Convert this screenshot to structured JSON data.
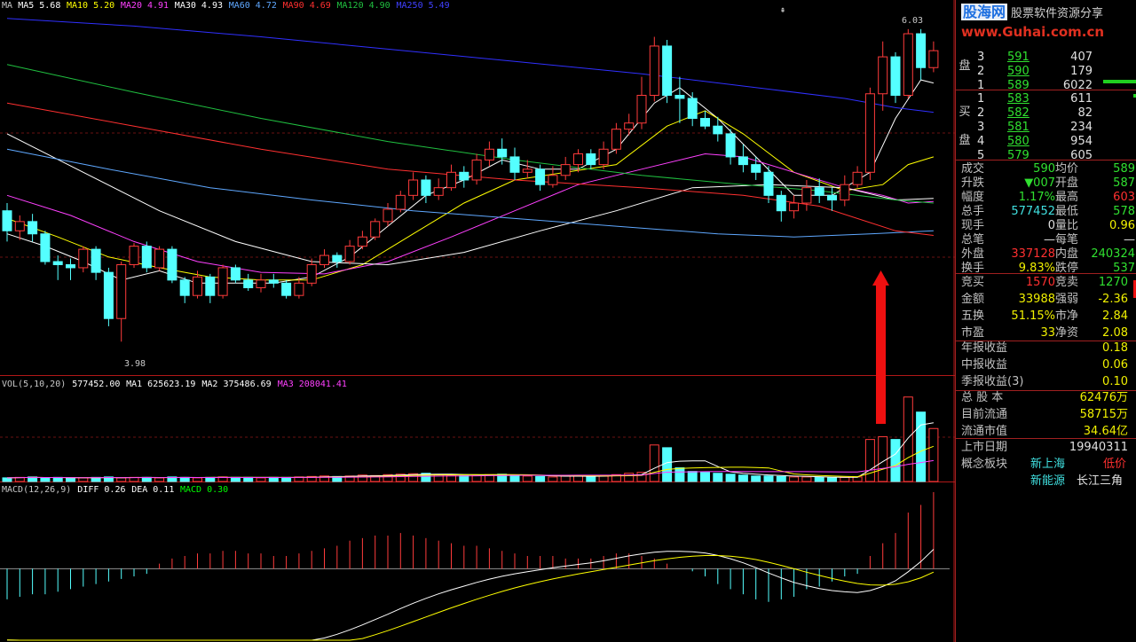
{
  "colors": {
    "up": "#ff3b3b",
    "down": "#54ffff",
    "ma5": "#ffffff",
    "ma10": "#ffff00",
    "ma20": "#ff40ff",
    "ma30": "#00ff00",
    "ma60": "#5fa8ff",
    "ma90": "#ff2020",
    "ma120": "#20a040",
    "ma250": "#3030ff",
    "grid": "#8b1010",
    "red_text": "#ff3030",
    "green_text": "#30e030",
    "yellow": "#ffff00"
  },
  "header": {
    "ma": [
      {
        "label": "MA",
        "color": "#c8c8c8"
      },
      {
        "label": "MA5 5.68",
        "color": "#ffffff"
      },
      {
        "label": "MA10 5.20",
        "color": "#ffff00"
      },
      {
        "label": "MA20 4.91",
        "color": "#ff40ff"
      },
      {
        "label": "MA30 4.93",
        "color": "#ffffff"
      },
      {
        "label": "MA60 4.72",
        "color": "#5fa8ff"
      },
      {
        "label": "MA90 4.69",
        "color": "#ff3030"
      },
      {
        "label": "MA120 4.90",
        "color": "#20c040"
      },
      {
        "label": "MA250 5.49",
        "color": "#4040ff"
      }
    ],
    "vol": [
      {
        "label": "VOL(5,10,20)",
        "color": "#c8c8c8"
      },
      {
        "label": "577452.00",
        "color": "#ffffff"
      },
      {
        "label": "MA1 625623.19",
        "color": "#ffffff"
      },
      {
        "label": "MA2 375486.69",
        "color": "#ffffff"
      },
      {
        "label": "MA3 208041.41",
        "color": "#ff40ff"
      }
    ],
    "macd": [
      {
        "label": "MACD(12,26,9)",
        "color": "#c8c8c8"
      },
      {
        "label": "DIFF 0.26",
        "color": "#ffffff"
      },
      {
        "label": "DEA 0.11",
        "color": "#ffffff"
      },
      {
        "label": "MACD 0.30",
        "color": "#00ff00"
      }
    ]
  },
  "chart_data": {
    "type": "candlestick",
    "price_high_label": "6.03",
    "price_low_label": "3.98",
    "price_ylim": [
      3.8,
      6.15
    ],
    "candles": [
      [
        4.85,
        4.72,
        4.9,
        4.65
      ],
      [
        4.72,
        4.78,
        4.82,
        4.66
      ],
      [
        4.78,
        4.7,
        4.83,
        4.65
      ],
      [
        4.7,
        4.52,
        4.72,
        4.5
      ],
      [
        4.52,
        4.5,
        4.56,
        4.4
      ],
      [
        4.5,
        4.48,
        4.54,
        4.4
      ],
      [
        4.48,
        4.6,
        4.62,
        4.45
      ],
      [
        4.6,
        4.45,
        4.62,
        4.4
      ],
      [
        4.45,
        4.15,
        4.48,
        4.1
      ],
      [
        4.15,
        4.5,
        4.52,
        4.0
      ],
      [
        4.5,
        4.62,
        4.64,
        4.48
      ],
      [
        4.62,
        4.48,
        4.65,
        4.45
      ],
      [
        4.48,
        4.6,
        4.62,
        4.46
      ],
      [
        4.6,
        4.4,
        4.62,
        4.38
      ],
      [
        4.4,
        4.3,
        4.42,
        4.25
      ],
      [
        4.3,
        4.42,
        4.46,
        4.28
      ],
      [
        4.42,
        4.3,
        4.44,
        4.25
      ],
      [
        4.3,
        4.48,
        4.5,
        4.28
      ],
      [
        4.48,
        4.4,
        4.5,
        4.38
      ],
      [
        4.4,
        4.35,
        4.44,
        4.33
      ],
      [
        4.35,
        4.4,
        4.44,
        4.32
      ],
      [
        4.4,
        4.38,
        4.44,
        4.35
      ],
      [
        4.38,
        4.3,
        4.4,
        4.28
      ],
      [
        4.3,
        4.38,
        4.42,
        4.28
      ],
      [
        4.38,
        4.5,
        4.54,
        4.36
      ],
      [
        4.5,
        4.56,
        4.6,
        4.48
      ],
      [
        4.56,
        4.52,
        4.58,
        4.48
      ],
      [
        4.52,
        4.62,
        4.66,
        4.5
      ],
      [
        4.62,
        4.68,
        4.72,
        4.6
      ],
      [
        4.68,
        4.78,
        4.8,
        4.66
      ],
      [
        4.78,
        4.86,
        4.9,
        4.75
      ],
      [
        4.86,
        4.95,
        4.98,
        4.84
      ],
      [
        4.95,
        5.05,
        5.1,
        4.92
      ],
      [
        5.05,
        4.95,
        5.08,
        4.9
      ],
      [
        4.95,
        5.0,
        5.06,
        4.92
      ],
      [
        5.0,
        5.1,
        5.15,
        4.98
      ],
      [
        5.1,
        5.05,
        5.14,
        5.0
      ],
      [
        5.05,
        5.18,
        5.22,
        5.02
      ],
      [
        5.18,
        5.25,
        5.3,
        5.14
      ],
      [
        5.25,
        5.2,
        5.32,
        5.15
      ],
      [
        5.2,
        5.1,
        5.26,
        5.05
      ],
      [
        5.1,
        5.12,
        5.18,
        5.06
      ],
      [
        5.12,
        5.02,
        5.15,
        4.98
      ],
      [
        5.02,
        5.08,
        5.14,
        5.0
      ],
      [
        5.08,
        5.15,
        5.2,
        5.05
      ],
      [
        5.15,
        5.22,
        5.25,
        5.1
      ],
      [
        5.22,
        5.15,
        5.25,
        5.12
      ],
      [
        5.15,
        5.25,
        5.3,
        5.12
      ],
      [
        5.25,
        5.38,
        5.42,
        5.22
      ],
      [
        5.38,
        5.42,
        5.48,
        5.34
      ],
      [
        5.42,
        5.6,
        5.72,
        5.38
      ],
      [
        5.6,
        5.92,
        5.98,
        5.56
      ],
      [
        5.92,
        5.6,
        5.96,
        5.55
      ],
      [
        5.6,
        5.58,
        5.72,
        5.42
      ],
      [
        5.58,
        5.45,
        5.62,
        5.4
      ],
      [
        5.45,
        5.4,
        5.5,
        5.38
      ],
      [
        5.4,
        5.35,
        5.46,
        5.3
      ],
      [
        5.35,
        5.2,
        5.38,
        5.15
      ],
      [
        5.2,
        5.15,
        5.28,
        5.1
      ],
      [
        5.15,
        5.1,
        5.2,
        5.05
      ],
      [
        5.1,
        4.95,
        5.14,
        4.9
      ],
      [
        4.95,
        4.85,
        4.98,
        4.78
      ],
      [
        4.85,
        4.9,
        4.95,
        4.8
      ],
      [
        4.9,
        5.0,
        5.05,
        4.85
      ],
      [
        5.0,
        4.95,
        5.06,
        4.9
      ],
      [
        4.95,
        4.92,
        5.0,
        4.85
      ],
      [
        4.92,
        5.02,
        5.08,
        4.88
      ],
      [
        5.02,
        5.1,
        5.14,
        5.0
      ],
      [
        5.1,
        5.61,
        5.65,
        5.05
      ],
      [
        5.61,
        5.85,
        5.95,
        5.5
      ],
      [
        5.85,
        5.6,
        5.88,
        5.55
      ],
      [
        5.6,
        6.0,
        6.03,
        5.58
      ],
      [
        6.0,
        5.78,
        6.03,
        5.7
      ],
      [
        5.78,
        5.89,
        5.95,
        5.75
      ]
    ],
    "ma_curves": [
      {
        "name": "MA5",
        "color": "#ffffff",
        "pts": [
          [
            0,
            4.7
          ],
          [
            3,
            4.62
          ],
          [
            6,
            4.52
          ],
          [
            9,
            4.4
          ],
          [
            12,
            4.46
          ],
          [
            15,
            4.38
          ],
          [
            18,
            4.38
          ],
          [
            21,
            4.38
          ],
          [
            24,
            4.42
          ],
          [
            27,
            4.55
          ],
          [
            30,
            4.75
          ],
          [
            33,
            4.95
          ],
          [
            36,
            5.05
          ],
          [
            39,
            5.18
          ],
          [
            42,
            5.12
          ],
          [
            45,
            5.12
          ],
          [
            48,
            5.25
          ],
          [
            51,
            5.55
          ],
          [
            53,
            5.65
          ],
          [
            56,
            5.45
          ],
          [
            59,
            5.2
          ],
          [
            62,
            4.95
          ],
          [
            65,
            4.95
          ],
          [
            68,
            5.1
          ],
          [
            70,
            5.45
          ],
          [
            72,
            5.7
          ],
          [
            73,
            5.68
          ]
        ]
      },
      {
        "name": "MA10",
        "color": "#ffff00",
        "pts": [
          [
            0,
            4.8
          ],
          [
            4,
            4.68
          ],
          [
            8,
            4.55
          ],
          [
            12,
            4.48
          ],
          [
            16,
            4.42
          ],
          [
            20,
            4.4
          ],
          [
            24,
            4.4
          ],
          [
            28,
            4.5
          ],
          [
            32,
            4.7
          ],
          [
            36,
            4.9
          ],
          [
            40,
            5.05
          ],
          [
            44,
            5.1
          ],
          [
            48,
            5.15
          ],
          [
            52,
            5.4
          ],
          [
            55,
            5.5
          ],
          [
            58,
            5.35
          ],
          [
            62,
            5.1
          ],
          [
            66,
            4.98
          ],
          [
            69,
            5.02
          ],
          [
            71,
            5.15
          ],
          [
            73,
            5.2
          ]
        ]
      },
      {
        "name": "MA20",
        "color": "#ff40ff",
        "pts": [
          [
            0,
            4.95
          ],
          [
            5,
            4.82
          ],
          [
            10,
            4.65
          ],
          [
            15,
            4.52
          ],
          [
            20,
            4.45
          ],
          [
            25,
            4.44
          ],
          [
            30,
            4.52
          ],
          [
            35,
            4.68
          ],
          [
            40,
            4.85
          ],
          [
            45,
            5.02
          ],
          [
            50,
            5.12
          ],
          [
            55,
            5.22
          ],
          [
            58,
            5.2
          ],
          [
            62,
            5.1
          ],
          [
            66,
            5.0
          ],
          [
            69,
            4.95
          ],
          [
            71,
            4.9
          ],
          [
            73,
            4.91
          ]
        ]
      },
      {
        "name": "MA30",
        "color": "#ffffff",
        "pts": [
          [
            0,
            5.35
          ],
          [
            6,
            5.1
          ],
          [
            12,
            4.85
          ],
          [
            18,
            4.65
          ],
          [
            24,
            4.52
          ],
          [
            30,
            4.5
          ],
          [
            36,
            4.58
          ],
          [
            42,
            4.72
          ],
          [
            48,
            4.85
          ],
          [
            54,
            5.0
          ],
          [
            60,
            5.02
          ],
          [
            66,
            5.0
          ],
          [
            70,
            4.92
          ],
          [
            73,
            4.93
          ]
        ]
      },
      {
        "name": "MA60",
        "color": "#5fa8ff",
        "pts": [
          [
            0,
            5.25
          ],
          [
            8,
            5.12
          ],
          [
            16,
            5.0
          ],
          [
            24,
            4.92
          ],
          [
            32,
            4.85
          ],
          [
            40,
            4.8
          ],
          [
            48,
            4.75
          ],
          [
            56,
            4.7
          ],
          [
            62,
            4.68
          ],
          [
            68,
            4.7
          ],
          [
            73,
            4.72
          ]
        ]
      },
      {
        "name": "MA90",
        "color": "#ff3030",
        "pts": [
          [
            0,
            5.55
          ],
          [
            10,
            5.4
          ],
          [
            20,
            5.25
          ],
          [
            30,
            5.12
          ],
          [
            40,
            5.05
          ],
          [
            50,
            5.0
          ],
          [
            58,
            4.95
          ],
          [
            64,
            4.88
          ],
          [
            70,
            4.72
          ],
          [
            73,
            4.69
          ]
        ]
      },
      {
        "name": "MA120",
        "color": "#20c040",
        "pts": [
          [
            0,
            5.8
          ],
          [
            10,
            5.62
          ],
          [
            20,
            5.45
          ],
          [
            30,
            5.3
          ],
          [
            40,
            5.18
          ],
          [
            50,
            5.08
          ],
          [
            58,
            5.02
          ],
          [
            64,
            4.98
          ],
          [
            70,
            4.92
          ],
          [
            73,
            4.9
          ]
        ]
      },
      {
        "name": "MA250",
        "color": "#3030ff",
        "pts": [
          [
            0,
            6.1
          ],
          [
            10,
            6.05
          ],
          [
            20,
            5.98
          ],
          [
            30,
            5.9
          ],
          [
            40,
            5.82
          ],
          [
            50,
            5.74
          ],
          [
            60,
            5.64
          ],
          [
            66,
            5.58
          ],
          [
            70,
            5.52
          ],
          [
            73,
            5.49
          ]
        ]
      }
    ],
    "volume": [
      8,
      9,
      10,
      8,
      9,
      7,
      8,
      9,
      10,
      8,
      9,
      9,
      8,
      10,
      9,
      8,
      9,
      10,
      9,
      9,
      8,
      9,
      9,
      10,
      11,
      12,
      11,
      12,
      14,
      13,
      15,
      16,
      17,
      18,
      15,
      14,
      13,
      14,
      15,
      16,
      13,
      12,
      11,
      10,
      12,
      13,
      11,
      12,
      15,
      18,
      20,
      80,
      74,
      30,
      22,
      20,
      18,
      16,
      14,
      12,
      12,
      11,
      10,
      10,
      9,
      8,
      9,
      10,
      92,
      98,
      92,
      185,
      152,
      116
    ],
    "volume_ylim": [
      0,
      200
    ],
    "macd_hist": [
      -0.12,
      -0.11,
      -0.1,
      -0.1,
      -0.09,
      -0.08,
      -0.07,
      -0.06,
      -0.05,
      -0.04,
      -0.03,
      -0.02,
      0.02,
      0.04,
      0.05,
      0.06,
      0.06,
      0.07,
      0.07,
      0.06,
      0.06,
      0.05,
      0.05,
      0.06,
      0.07,
      0.08,
      0.09,
      0.11,
      0.12,
      0.13,
      0.13,
      0.14,
      0.13,
      0.12,
      0.11,
      0.1,
      0.09,
      0.09,
      0.08,
      0.07,
      0.06,
      0.05,
      0.05,
      0.05,
      0.04,
      0.04,
      0.04,
      0.05,
      0.06,
      0.06,
      0.05,
      0.04,
      0.02,
      0.0,
      -0.01,
      -0.03,
      -0.06,
      -0.08,
      -0.1,
      -0.12,
      -0.13,
      -0.12,
      -0.11,
      -0.08,
      -0.07,
      -0.05,
      -0.03,
      -0.02,
      0.05,
      0.1,
      0.14,
      0.22,
      0.25,
      0.3
    ],
    "macd_ylim": [
      -0.28,
      0.3
    ]
  },
  "watermark": {
    "site": "股海网",
    "slogan": "股票软件资源分享",
    "url": "www.Guhai.com.cn"
  },
  "sell_orders": [
    {
      "lvl": "3",
      "price": "591",
      "vol": "407"
    },
    {
      "lvl": "2",
      "price": "590",
      "vol": "179"
    },
    {
      "lvl": "1",
      "price": "589",
      "vol": "6022"
    }
  ],
  "buy_orders": [
    {
      "lvl": "1",
      "price": "583",
      "vol": "611"
    },
    {
      "lvl": "2",
      "price": "582",
      "vol": "82"
    },
    {
      "lvl": "3",
      "price": "581",
      "vol": "234"
    },
    {
      "lvl": "4",
      "price": "580",
      "vol": "954"
    },
    {
      "lvl": "5",
      "price": "579",
      "vol": "605"
    }
  ],
  "sell_label": "盘",
  "buy_label": "买",
  "buy_label2": "盘",
  "quote": [
    {
      "l": "成交",
      "lv": "590",
      "r": "均价",
      "rv": "589",
      "lc": "grn",
      "rc": "grn"
    },
    {
      "l": "升跌",
      "lv": "▼007",
      "r": "开盘",
      "rv": "587",
      "lc": "grn",
      "rc": "grn"
    },
    {
      "l": "幅度",
      "lv": "1.17%",
      "r": "最高",
      "rv": "603",
      "lc": "grn",
      "rc": "red"
    },
    {
      "l": "总手",
      "lv": "577452",
      "r": "最低",
      "rv": "578",
      "lc": "cyan",
      "rc": "grn"
    },
    {
      "l": "现手",
      "lv": "0",
      "r": "量比",
      "rv": "0.96",
      "lc": "wht",
      "rc": "yel"
    },
    {
      "l": "总笔",
      "lv": "—",
      "r": "每笔",
      "rv": "—",
      "lc": "wht",
      "rc": "wht"
    },
    {
      "l": "外盘",
      "lv": "337128",
      "r": "内盘",
      "rv": "240324",
      "lc": "red",
      "rc": "grn"
    },
    {
      "l": "换手",
      "lv": "9.83%",
      "r": "跌停",
      "rv": "537",
      "lc": "yel",
      "rc": "grn"
    }
  ],
  "auction": [
    {
      "l": "竞买",
      "lv": "1570",
      "r": "竞卖",
      "rv": "1270",
      "lc": "red",
      "rc": "grn"
    },
    {
      "l": "金额",
      "lv": "33988",
      "r": "强弱",
      "rv": "-2.36",
      "lc": "yel",
      "rc": "yel"
    },
    {
      "l": "五换",
      "lv": "51.15%",
      "r": "市净",
      "rv": "2.84",
      "lc": "yel",
      "rc": "yel"
    },
    {
      "l": "市盈",
      "lv": "33",
      "r": "净资",
      "rv": "2.08",
      "lc": "yel",
      "rc": "yel"
    }
  ],
  "earnings": [
    {
      "l": "年报收益",
      "v": "0.18"
    },
    {
      "l": "中报收益",
      "v": "0.06"
    },
    {
      "l": "季报收益(3)",
      "v": "0.10"
    }
  ],
  "shares": [
    {
      "l": "总 股 本",
      "v": "62476万"
    },
    {
      "l": "目前流通",
      "v": "58715万"
    },
    {
      "l": "流通市值",
      "v": "34.64亿"
    }
  ],
  "listing": {
    "l": "上市日期",
    "v": "19940311"
  },
  "concept": {
    "l": "概念板块",
    "a": "新上海",
    "b": "低价",
    "c": "新能源",
    "d": "长江三角"
  }
}
